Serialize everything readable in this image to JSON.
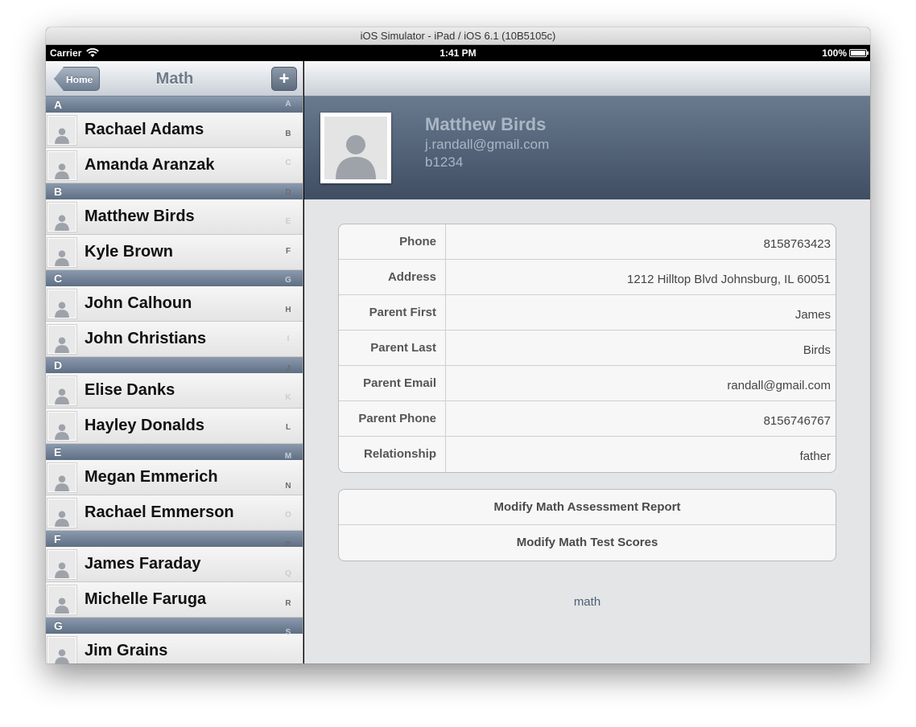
{
  "window": {
    "title": "iOS Simulator - iPad / iOS 6.1 (10B5105c)"
  },
  "status": {
    "carrier": "Carrier",
    "time": "1:41 PM",
    "battery": "100%"
  },
  "master": {
    "back_label": "Home",
    "title": "Math",
    "add_label": "+",
    "sections": [
      {
        "letter": "A",
        "rows": [
          "Rachael Adams",
          "Amanda Aranzak"
        ]
      },
      {
        "letter": "B",
        "rows": [
          "Matthew Birds",
          "Kyle Brown"
        ]
      },
      {
        "letter": "C",
        "rows": [
          "John Calhoun",
          "John Christians"
        ]
      },
      {
        "letter": "D",
        "rows": [
          "Elise Danks",
          "Hayley Donalds"
        ]
      },
      {
        "letter": "E",
        "rows": [
          "Megan Emmerich",
          "Rachael Emmerson"
        ]
      },
      {
        "letter": "F",
        "rows": [
          "James Faraday",
          "Michelle Faruga"
        ]
      },
      {
        "letter": "G",
        "rows": [
          "Jim Grains"
        ]
      }
    ],
    "index": [
      "A",
      "B",
      "C",
      "D",
      "E",
      "F",
      "G",
      "H",
      "I",
      "J",
      "K",
      "L",
      "M",
      "N",
      "O",
      "P",
      "Q",
      "R",
      "S"
    ]
  },
  "detail": {
    "name": "Matthew Birds",
    "email": "j.randall@gmail.com",
    "id": "b1234",
    "fields": [
      {
        "label": "Phone",
        "value": "8158763423"
      },
      {
        "label": "Address",
        "value": "1212 Hilltop Blvd Johnsburg, IL 60051"
      },
      {
        "label": "Parent First",
        "value": "James"
      },
      {
        "label": "Parent Last",
        "value": "Birds"
      },
      {
        "label": "Parent Email",
        "value": "randall@gmail.com"
      },
      {
        "label": "Parent Phone",
        "value": "8156746767"
      },
      {
        "label": "Relationship",
        "value": "father"
      }
    ],
    "actions": [
      "Modify Math Assessment Report",
      "Modify Math Test Scores"
    ],
    "footnote": "math"
  }
}
